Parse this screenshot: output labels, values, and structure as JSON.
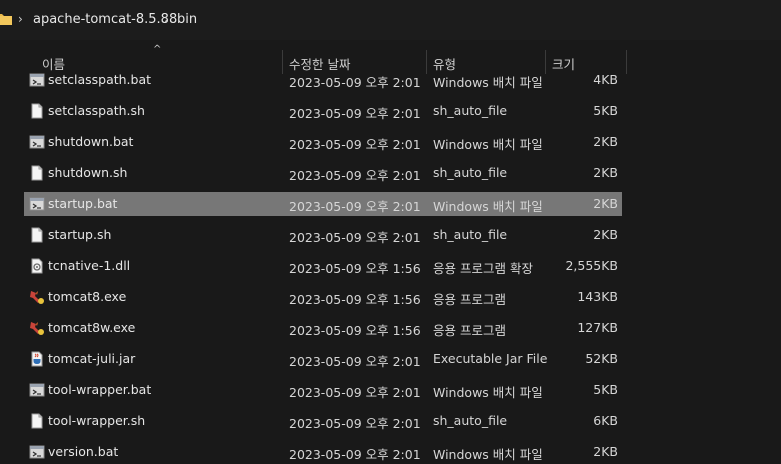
{
  "breadcrumb": {
    "items": [
      "apache-tomcat-8.5.88",
      "bin"
    ],
    "separator": "›"
  },
  "columns": {
    "name": "이름",
    "date": "수정한 날짜",
    "type": "유형",
    "size": "크기",
    "sort_indicator": "^"
  },
  "files": [
    {
      "name": "setclasspath.bat",
      "date": "2023-05-09 오후 2:01",
      "type": "Windows 배치 파일",
      "size": "4KB",
      "icon": "batch-file-icon",
      "selected": false
    },
    {
      "name": "setclasspath.sh",
      "date": "2023-05-09 오후 2:01",
      "type": "sh_auto_file",
      "size": "5KB",
      "icon": "document-icon",
      "selected": false
    },
    {
      "name": "shutdown.bat",
      "date": "2023-05-09 오후 2:01",
      "type": "Windows 배치 파일",
      "size": "2KB",
      "icon": "batch-file-icon",
      "selected": false
    },
    {
      "name": "shutdown.sh",
      "date": "2023-05-09 오후 2:01",
      "type": "sh_auto_file",
      "size": "2KB",
      "icon": "document-icon",
      "selected": false
    },
    {
      "name": "startup.bat",
      "date": "2023-05-09 오후 2:01",
      "type": "Windows 배치 파일",
      "size": "2KB",
      "icon": "batch-file-icon",
      "selected": true
    },
    {
      "name": "startup.sh",
      "date": "2023-05-09 오후 2:01",
      "type": "sh_auto_file",
      "size": "2KB",
      "icon": "document-icon",
      "selected": false
    },
    {
      "name": "tcnative-1.dll",
      "date": "2023-05-09 오후 1:56",
      "type": "응용 프로그램 확장",
      "size": "2,555KB",
      "icon": "dll-file-icon",
      "selected": false
    },
    {
      "name": "tomcat8.exe",
      "date": "2023-05-09 오후 1:56",
      "type": "응용 프로그램",
      "size": "143KB",
      "icon": "tomcat-exe-icon",
      "selected": false
    },
    {
      "name": "tomcat8w.exe",
      "date": "2023-05-09 오후 1:56",
      "type": "응용 프로그램",
      "size": "127KB",
      "icon": "tomcat-exe-icon",
      "selected": false
    },
    {
      "name": "tomcat-juli.jar",
      "date": "2023-05-09 오후 2:01",
      "type": "Executable Jar File",
      "size": "52KB",
      "icon": "jar-file-icon",
      "selected": false
    },
    {
      "name": "tool-wrapper.bat",
      "date": "2023-05-09 오후 2:01",
      "type": "Windows 배치 파일",
      "size": "5KB",
      "icon": "batch-file-icon",
      "selected": false
    },
    {
      "name": "tool-wrapper.sh",
      "date": "2023-05-09 오후 2:01",
      "type": "sh_auto_file",
      "size": "6KB",
      "icon": "document-icon",
      "selected": false
    },
    {
      "name": "version.bat",
      "date": "2023-05-09 오후 2:01",
      "type": "Windows 배치 파일",
      "size": "2KB",
      "icon": "batch-file-icon",
      "selected": false
    }
  ],
  "colors": {
    "background": "#191919",
    "selected_row": "#777777",
    "folder": "#e8b84a",
    "text": "#e6e6e6"
  }
}
